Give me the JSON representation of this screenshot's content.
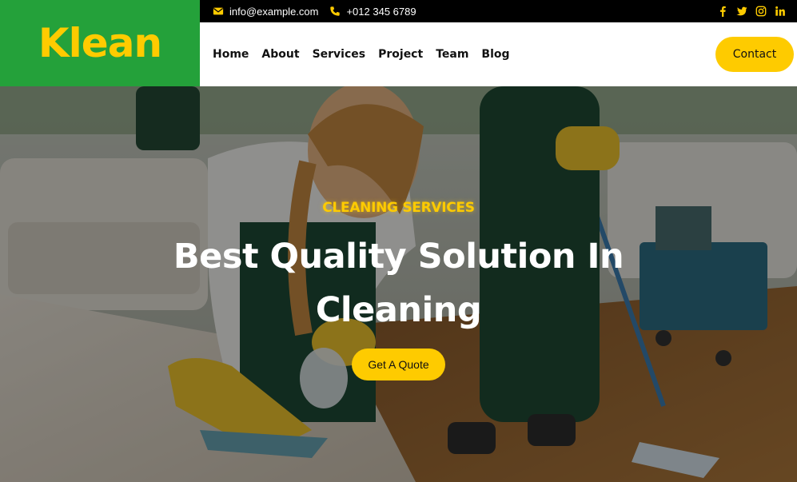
{
  "brand": {
    "name": "Klean",
    "bg_color": "#24a13a",
    "accent_color": "#fecb00"
  },
  "topbar": {
    "email": "info@example.com",
    "phone": "+012 345 6789",
    "email_icon": "envelope-icon",
    "phone_icon": "phone-icon",
    "socials": [
      "facebook-icon",
      "twitter-icon",
      "instagram-icon",
      "linkedin-icon"
    ]
  },
  "nav": {
    "items": [
      "Home",
      "About",
      "Services",
      "Project",
      "Team",
      "Blog"
    ],
    "contact_label": "Contact"
  },
  "hero": {
    "eyebrow": "CLEANING SERVICES",
    "headline": "Best Quality Solution In Cleaning",
    "cta_label": "Get A Quote"
  }
}
